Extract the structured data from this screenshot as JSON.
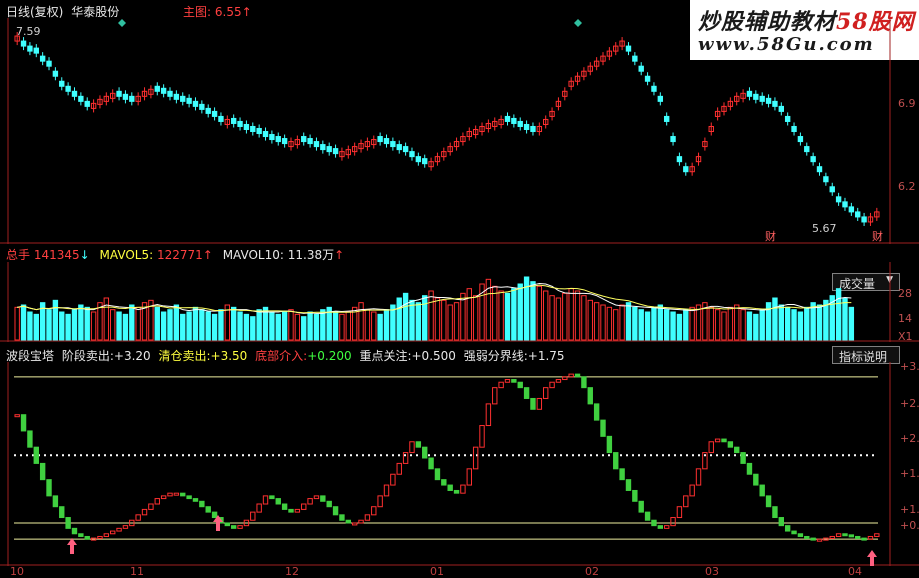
{
  "header": {
    "mode": "日线(复权)",
    "stock_name": "华泰股份",
    "main_label": "主图: 6.55",
    "arrow": "↑"
  },
  "watermark": {
    "line1_main": "炒股辅助教材",
    "line1_sub": "58股网",
    "line2": "www.58Gu.com"
  },
  "price_panel": {
    "high_label": "7.59",
    "low_label": "5.67",
    "y_axis": [
      "6.9",
      "6.2"
    ],
    "cai_mark": "财"
  },
  "volume_panel": {
    "total_label": "总手",
    "total_value": "141345",
    "ma5_label": "MAVOL5:",
    "ma5_value": "122771",
    "ma10_label": "MAVOL10:",
    "ma10_value": "11.38万",
    "dropdown": "成交量",
    "y_axis": [
      "28",
      "14",
      "X1"
    ]
  },
  "indicator_panel": {
    "name": "波段宝塔",
    "sell_label": "阶段卖出:",
    "sell_value": "+3.20",
    "clear_label": "清仓卖出:",
    "clear_value": "+3.50",
    "bottom_label": "底部介入:",
    "bottom_value": "+0.200",
    "focus_label": "重点关注:",
    "focus_value": "+0.500",
    "strength_label": "强弱分界线:",
    "strength_value": "+1.75",
    "help_button": "指标说明",
    "y_axis": [
      "+3.",
      "+2.",
      "+2.",
      "+1.",
      "+1.",
      "+0."
    ]
  },
  "x_axis": [
    "10",
    "11",
    "12",
    "01",
    "02",
    "03",
    "04"
  ],
  "colors": {
    "up": "#ff3030",
    "down": "#40ffff",
    "tower_up": "#ff3030",
    "tower_down": "#40d040",
    "level_line": "#f0f0a0"
  },
  "chart_data": {
    "type": "candlestick",
    "price_series": [
      7.55,
      7.45,
      7.4,
      7.38,
      7.3,
      7.25,
      7.15,
      7.05,
      7.0,
      6.95,
      6.9,
      6.85,
      6.88,
      6.92,
      6.95,
      6.98,
      6.95,
      6.92,
      6.9,
      6.95,
      7.0,
      7.02,
      7.0,
      6.98,
      6.95,
      6.92,
      6.9,
      6.88,
      6.85,
      6.82,
      6.78,
      6.75,
      6.7,
      6.72,
      6.68,
      6.65,
      6.62,
      6.6,
      6.58,
      6.55,
      6.52,
      6.5,
      6.48,
      6.5,
      6.52,
      6.5,
      6.48,
      6.45,
      6.42,
      6.4,
      6.38,
      6.4,
      6.42,
      6.45,
      6.48,
      6.5,
      6.52,
      6.5,
      6.48,
      6.45,
      6.42,
      6.4,
      6.35,
      6.3,
      6.28,
      6.3,
      6.35,
      6.4,
      6.45,
      6.5,
      6.55,
      6.6,
      6.62,
      6.65,
      6.68,
      6.7,
      6.72,
      6.7,
      6.68,
      6.65,
      6.62,
      6.6,
      6.65,
      6.72,
      6.8,
      6.9,
      7.0,
      7.1,
      7.15,
      7.2,
      7.25,
      7.3,
      7.35,
      7.4,
      7.45,
      7.5,
      7.4,
      7.3,
      7.2,
      7.1,
      7.0,
      6.9,
      6.7,
      6.5,
      6.3,
      6.2,
      6.25,
      6.35,
      6.5,
      6.65,
      6.8,
      6.85,
      6.9,
      6.95,
      6.98,
      6.95,
      6.92,
      6.9,
      6.88,
      6.85,
      6.8,
      6.7,
      6.6,
      6.5,
      6.4,
      6.3,
      6.2,
      6.1,
      6.0,
      5.9,
      5.85,
      5.8,
      5.75,
      5.7,
      5.75,
      5.8
    ],
    "volume_series": [
      14,
      15,
      12,
      11,
      16,
      13,
      17,
      12,
      11,
      13,
      15,
      14,
      12,
      16,
      18,
      13,
      12,
      11,
      15,
      14,
      16,
      17,
      14,
      12,
      13,
      15,
      11,
      12,
      14,
      13,
      12,
      11,
      13,
      15,
      14,
      12,
      11,
      10,
      13,
      14,
      12,
      11,
      12,
      13,
      11,
      10,
      12,
      11,
      13,
      14,
      12,
      11,
      12,
      14,
      16,
      13,
      12,
      11,
      13,
      15,
      18,
      20,
      17,
      16,
      19,
      21,
      18,
      17,
      15,
      16,
      20,
      22,
      19,
      24,
      26,
      23,
      21,
      20,
      22,
      24,
      27,
      25,
      23,
      21,
      19,
      18,
      20,
      22,
      21,
      19,
      17,
      16,
      15,
      14,
      13,
      15,
      16,
      14,
      13,
      12,
      14,
      15,
      13,
      12,
      11,
      13,
      14,
      15,
      16,
      14,
      13,
      12,
      14,
      15,
      13,
      12,
      11,
      13,
      16,
      18,
      15,
      14,
      13,
      12,
      14,
      16,
      15,
      17,
      19,
      22,
      18,
      14
    ],
    "tower_series": [
      2.5,
      2.2,
      1.9,
      1.6,
      1.3,
      1.0,
      0.8,
      0.6,
      0.4,
      0.3,
      0.25,
      0.2,
      0.22,
      0.25,
      0.3,
      0.35,
      0.4,
      0.45,
      0.55,
      0.65,
      0.75,
      0.85,
      0.95,
      1.0,
      1.05,
      1.05,
      1.0,
      0.95,
      0.9,
      0.8,
      0.7,
      0.6,
      0.5,
      0.45,
      0.4,
      0.45,
      0.55,
      0.7,
      0.85,
      1.0,
      0.95,
      0.85,
      0.75,
      0.7,
      0.75,
      0.85,
      0.95,
      1.0,
      0.9,
      0.8,
      0.65,
      0.55,
      0.5,
      0.5,
      0.55,
      0.65,
      0.8,
      1.0,
      1.2,
      1.4,
      1.6,
      1.8,
      2.0,
      1.9,
      1.7,
      1.5,
      1.3,
      1.2,
      1.1,
      1.05,
      1.2,
      1.5,
      1.9,
      2.3,
      2.7,
      3.0,
      3.1,
      3.15,
      3.1,
      3.0,
      2.8,
      2.6,
      2.8,
      3.0,
      3.1,
      3.15,
      3.2,
      3.25,
      3.2,
      3.0,
      2.7,
      2.4,
      2.1,
      1.8,
      1.5,
      1.3,
      1.1,
      0.9,
      0.7,
      0.55,
      0.45,
      0.4,
      0.45,
      0.6,
      0.8,
      1.0,
      1.2,
      1.5,
      1.8,
      2.0,
      2.05,
      2.0,
      1.9,
      1.8,
      1.6,
      1.4,
      1.2,
      1.0,
      0.8,
      0.6,
      0.45,
      0.35,
      0.3,
      0.25,
      0.22,
      0.2,
      0.2,
      0.22,
      0.25,
      0.3,
      0.28,
      0.25,
      0.22,
      0.2,
      0.25,
      0.3
    ]
  }
}
